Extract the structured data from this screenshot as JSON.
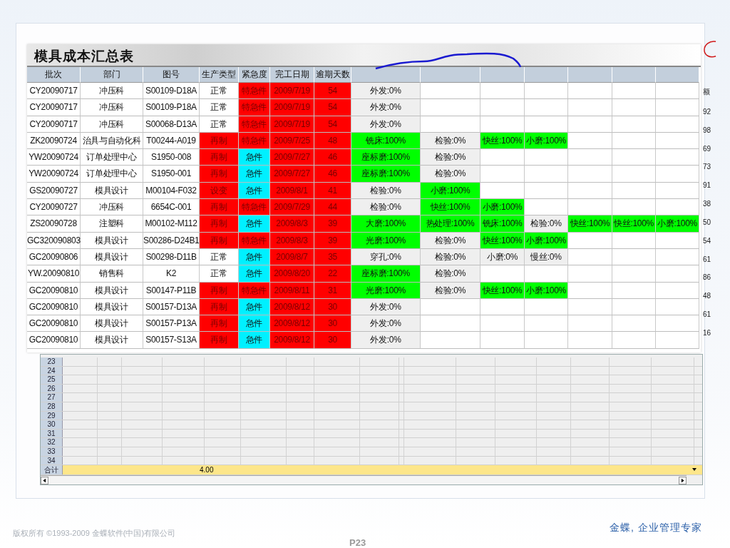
{
  "report": {
    "title": "模具成本汇总表",
    "columns": [
      "批次",
      "部门",
      "图号",
      "生产类型",
      "紧急度",
      "完工日期",
      "逾期天数"
    ],
    "rows": [
      {
        "batch": "CY20090717",
        "dept": "冲压科",
        "drawing": "S00109-D18A",
        "type": {
          "text": "正常",
          "flagged": false
        },
        "urgency": {
          "text": "特急件",
          "kind": "top"
        },
        "due": "2009/7/19",
        "overdue": "54",
        "steps": [
          {
            "text": "外发:0%",
            "done": false
          }
        ]
      },
      {
        "batch": "CY20090717",
        "dept": "冲压科",
        "drawing": "S00109-P18A",
        "type": {
          "text": "正常",
          "flagged": false
        },
        "urgency": {
          "text": "特急件",
          "kind": "top"
        },
        "due": "2009/7/19",
        "overdue": "54",
        "steps": [
          {
            "text": "外发:0%",
            "done": false
          }
        ]
      },
      {
        "batch": "CY20090717",
        "dept": "冲压科",
        "drawing": "S00068-D13A",
        "type": {
          "text": "正常",
          "flagged": false
        },
        "urgency": {
          "text": "特急件",
          "kind": "top"
        },
        "due": "2009/7/19",
        "overdue": "54",
        "steps": [
          {
            "text": "外发:0%",
            "done": false
          }
        ]
      },
      {
        "batch": "ZK20090724",
        "dept": "治具与自动化科",
        "drawing": "T00244-A019",
        "type": {
          "text": "再制",
          "flagged": true
        },
        "urgency": {
          "text": "特急件",
          "kind": "top"
        },
        "due": "2009/7/25",
        "overdue": "48",
        "steps": [
          {
            "text": "铣床:100%",
            "done": true
          },
          {
            "text": "检验:0%",
            "done": false
          },
          {
            "text": "快丝:100%",
            "done": true
          },
          {
            "text": "小磨:100%",
            "done": true
          }
        ]
      },
      {
        "batch": "YW20090724",
        "dept": "订单处理中心",
        "drawing": "S1950-008",
        "type": {
          "text": "再制",
          "flagged": true
        },
        "urgency": {
          "text": "急件",
          "kind": "rush"
        },
        "due": "2009/7/27",
        "overdue": "46",
        "steps": [
          {
            "text": "座标磨:100%",
            "done": true
          },
          {
            "text": "检验:0%",
            "done": false
          }
        ]
      },
      {
        "batch": "YW20090724",
        "dept": "订单处理中心",
        "drawing": "S1950-001",
        "type": {
          "text": "再制",
          "flagged": true
        },
        "urgency": {
          "text": "急件",
          "kind": "rush"
        },
        "due": "2009/7/27",
        "overdue": "46",
        "steps": [
          {
            "text": "座标磨:100%",
            "done": true
          },
          {
            "text": "检验:0%",
            "done": false
          }
        ]
      },
      {
        "batch": "GS20090727",
        "dept": "模具设计",
        "drawing": "M00104-F032",
        "type": {
          "text": "设变",
          "flagged": true
        },
        "urgency": {
          "text": "急件",
          "kind": "rush"
        },
        "due": "2009/8/1",
        "overdue": "41",
        "steps": [
          {
            "text": "检验:0%",
            "done": false
          },
          {
            "text": "小磨:100%",
            "done": true
          }
        ]
      },
      {
        "batch": "CY20090727",
        "dept": "冲压科",
        "drawing": "6654C-001",
        "type": {
          "text": "再制",
          "flagged": true
        },
        "urgency": {
          "text": "特急件",
          "kind": "top"
        },
        "due": "2009/7/29",
        "overdue": "44",
        "steps": [
          {
            "text": "检验:0%",
            "done": false
          },
          {
            "text": "快丝:100%",
            "done": true
          },
          {
            "text": "小磨:100%",
            "done": true
          }
        ]
      },
      {
        "batch": "ZS20090728",
        "dept": "注塑科",
        "drawing": "M00102-M112",
        "type": {
          "text": "再制",
          "flagged": true
        },
        "urgency": {
          "text": "急件",
          "kind": "rush"
        },
        "due": "2009/8/3",
        "overdue": "39",
        "steps": [
          {
            "text": "大磨:100%",
            "done": true
          },
          {
            "text": "热处理:100%",
            "done": true
          },
          {
            "text": "铣床:100%",
            "done": true
          },
          {
            "text": "检验:0%",
            "done": false
          },
          {
            "text": "快丝:100%",
            "done": true
          },
          {
            "text": "快丝:100%",
            "done": true
          },
          {
            "text": "小磨:100%",
            "done": true
          }
        ]
      },
      {
        "batch": "GC320090803",
        "dept": "模具设计",
        "drawing": "S00286-D24B1",
        "type": {
          "text": "再制",
          "flagged": true
        },
        "urgency": {
          "text": "特急件",
          "kind": "top"
        },
        "due": "2009/8/3",
        "overdue": "39",
        "steps": [
          {
            "text": "光磨:100%",
            "done": true
          },
          {
            "text": "检验:0%",
            "done": false
          },
          {
            "text": "快丝:100%",
            "done": true
          },
          {
            "text": "小磨:100%",
            "done": true
          }
        ]
      },
      {
        "batch": "GC20090806",
        "dept": "模具设计",
        "drawing": "S00298-D11B",
        "type": {
          "text": "正常",
          "flagged": false
        },
        "urgency": {
          "text": "急件",
          "kind": "rush"
        },
        "due": "2009/8/7",
        "overdue": "35",
        "steps": [
          {
            "text": "穿孔:0%",
            "done": false
          },
          {
            "text": "检验:0%",
            "done": false
          },
          {
            "text": "小磨:0%",
            "done": false
          },
          {
            "text": "慢丝:0%",
            "done": false
          }
        ]
      },
      {
        "batch": "YW.20090810",
        "dept": "销售科",
        "drawing": "K2",
        "type": {
          "text": "正常",
          "flagged": false
        },
        "urgency": {
          "text": "急件",
          "kind": "rush"
        },
        "due": "2009/8/20",
        "overdue": "22",
        "steps": [
          {
            "text": "座标磨:100%",
            "done": true
          },
          {
            "text": "检验:0%",
            "done": false
          }
        ]
      },
      {
        "batch": "GC20090810",
        "dept": "模具设计",
        "drawing": "S00147-P11B",
        "type": {
          "text": "再制",
          "flagged": true
        },
        "urgency": {
          "text": "特急件",
          "kind": "top"
        },
        "due": "2009/8/11",
        "overdue": "31",
        "steps": [
          {
            "text": "光磨:100%",
            "done": true
          },
          {
            "text": "检验:0%",
            "done": false
          },
          {
            "text": "快丝:100%",
            "done": true
          },
          {
            "text": "小磨:100%",
            "done": true
          }
        ]
      },
      {
        "batch": "GC20090810",
        "dept": "模具设计",
        "drawing": "S00157-D13A",
        "type": {
          "text": "再制",
          "flagged": true
        },
        "urgency": {
          "text": "急件",
          "kind": "rush"
        },
        "due": "2009/8/12",
        "overdue": "30",
        "steps": [
          {
            "text": "外发:0%",
            "done": false
          }
        ]
      },
      {
        "batch": "GC20090810",
        "dept": "模具设计",
        "drawing": "S00157-P13A",
        "type": {
          "text": "再制",
          "flagged": true
        },
        "urgency": {
          "text": "急件",
          "kind": "rush"
        },
        "due": "2009/8/12",
        "overdue": "30",
        "steps": [
          {
            "text": "外发:0%",
            "done": false
          }
        ]
      },
      {
        "batch": "GC20090810",
        "dept": "模具设计",
        "drawing": "S00157-S13A",
        "type": {
          "text": "再制",
          "flagged": true
        },
        "urgency": {
          "text": "急件",
          "kind": "rush"
        },
        "due": "2009/8/12",
        "overdue": "30",
        "steps": [
          {
            "text": "外发:0%",
            "done": false
          }
        ]
      }
    ]
  },
  "side_column": [
    "额",
    "92",
    "98",
    "69",
    "73",
    "91",
    "38",
    "50",
    "54",
    "61",
    "86",
    "48",
    "61",
    "16"
  ],
  "back_sheet": {
    "row_numbers": [
      "23",
      "24",
      "25",
      "26",
      "27",
      "28",
      "29",
      "30",
      "31",
      "32",
      "33",
      "34"
    ],
    "total_label": "合计",
    "total_value": "4.00"
  },
  "footer": {
    "copyright": "版权所有 ©1993-2009 金蝶软件(中国)有限公司",
    "page": "P23",
    "slogan": "金蝶, 企业管理专家"
  }
}
